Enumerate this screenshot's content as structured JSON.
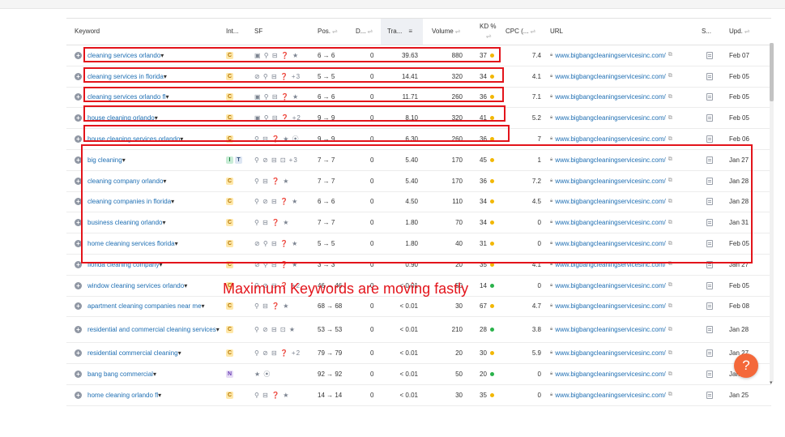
{
  "columns": {
    "keyword": "Keyword",
    "intent": "Int...",
    "sf": "SF",
    "pos": "Pos.",
    "diff": "D...",
    "traffic": "Tra...",
    "volume": "Volume",
    "kd": "KD %",
    "cpc": "CPC (...",
    "url": "URL",
    "serp": "S...",
    "updated": "Upd."
  },
  "colors": {
    "link": "#1f6fb3",
    "annotation": "#e3141b",
    "kd_yellow": "#f2b705",
    "kd_green": "#2ab24b",
    "help_button": "#f4683a"
  },
  "rows": [
    {
      "keyword": "cleaning services orlando",
      "intents": [
        "C"
      ],
      "sf": "▣ ⚲ ⊟ ❓ ★",
      "sf_extra": "",
      "pos": "6 → 6",
      "diff": "0",
      "traffic": "39.63",
      "volume": "880",
      "kd": "37",
      "kd_color": "yellow",
      "cpc": "7.4",
      "url": "www.bigbangcleaningservicesinc.com/",
      "updated": "Feb 07"
    },
    {
      "keyword": "cleaning services in florida",
      "intents": [
        "C"
      ],
      "sf": "⊘ ⚲ ⊟ ❓",
      "sf_extra": "+3",
      "pos": "5 → 5",
      "diff": "0",
      "traffic": "14.41",
      "volume": "320",
      "kd": "34",
      "kd_color": "yellow",
      "cpc": "4.1",
      "url": "www.bigbangcleaningservicesinc.com/",
      "updated": "Feb 05"
    },
    {
      "keyword": "cleaning services orlando fl",
      "intents": [
        "C"
      ],
      "sf": "▣ ⚲ ⊟ ❓ ★",
      "sf_extra": "",
      "pos": "6 → 6",
      "diff": "0",
      "traffic": "11.71",
      "volume": "260",
      "kd": "36",
      "kd_color": "yellow",
      "cpc": "7.1",
      "url": "www.bigbangcleaningservicesinc.com/",
      "updated": "Feb 05"
    },
    {
      "keyword": "house cleaning orlando",
      "intents": [
        "C"
      ],
      "sf": "▣ ⚲ ⊟ ❓",
      "sf_extra": "+2",
      "pos": "9 → 9",
      "diff": "0",
      "traffic": "8.10",
      "volume": "320",
      "kd": "41",
      "kd_color": "yellow",
      "cpc": "5.2",
      "url": "www.bigbangcleaningservicesinc.com/",
      "updated": "Feb 05"
    },
    {
      "keyword": "house cleaning services orlando",
      "intents": [
        "C"
      ],
      "sf": "⚲ ⊟ ❓ ★ ⦿",
      "sf_extra": "",
      "pos": "9 → 9",
      "diff": "0",
      "traffic": "6.30",
      "volume": "260",
      "kd": "36",
      "kd_color": "yellow",
      "cpc": "7",
      "url": "www.bigbangcleaningservicesinc.com/",
      "updated": "Feb 06"
    },
    {
      "keyword": "big cleaning",
      "intents": [
        "I",
        "T"
      ],
      "sf": "⚲ ⊘ ⊟ ⊡",
      "sf_extra": "+3",
      "pos": "7 → 7",
      "diff": "0",
      "traffic": "5.40",
      "volume": "170",
      "kd": "45",
      "kd_color": "yellow",
      "cpc": "1",
      "url": "www.bigbangcleaningservicesinc.com/",
      "updated": "Jan 27"
    },
    {
      "keyword": "cleaning company orlando",
      "intents": [
        "C"
      ],
      "sf": "⚲ ⊟ ❓ ★",
      "sf_extra": "",
      "pos": "7 → 7",
      "diff": "0",
      "traffic": "5.40",
      "volume": "170",
      "kd": "36",
      "kd_color": "yellow",
      "cpc": "7.2",
      "url": "www.bigbangcleaningservicesinc.com/",
      "updated": "Jan 28"
    },
    {
      "keyword": "cleaning companies in florida",
      "intents": [
        "C"
      ],
      "sf": "⚲ ⊘ ⊟ ❓ ★",
      "sf_extra": "",
      "pos": "6 → 6",
      "diff": "0",
      "traffic": "4.50",
      "volume": "110",
      "kd": "34",
      "kd_color": "yellow",
      "cpc": "4.5",
      "url": "www.bigbangcleaningservicesinc.com/",
      "updated": "Jan 28"
    },
    {
      "keyword": "business cleaning orlando",
      "intents": [
        "C"
      ],
      "sf": "⚲ ⊟ ❓ ★",
      "sf_extra": "",
      "pos": "7 → 7",
      "diff": "0",
      "traffic": "1.80",
      "volume": "70",
      "kd": "34",
      "kd_color": "yellow",
      "cpc": "0",
      "url": "www.bigbangcleaningservicesinc.com/",
      "updated": "Jan 31"
    },
    {
      "keyword": "home cleaning services florida",
      "intents": [
        "C"
      ],
      "sf": "⊘ ⚲ ⊟ ❓ ★",
      "sf_extra": "",
      "pos": "5 → 5",
      "diff": "0",
      "traffic": "1.80",
      "volume": "40",
      "kd": "31",
      "kd_color": "yellow",
      "cpc": "0",
      "url": "www.bigbangcleaningservicesinc.com/",
      "updated": "Feb 05"
    },
    {
      "keyword": "florida cleaning company",
      "intents": [
        "C"
      ],
      "sf": "⊘ ⚲ ⊟ ❓ ★",
      "sf_extra": "",
      "pos": "3 → 3",
      "diff": "0",
      "traffic": "0.90",
      "volume": "20",
      "kd": "35",
      "kd_color": "yellow",
      "cpc": "4.1",
      "url": "www.bigbangcleaningservicesinc.com/",
      "updated": "Jan 27"
    },
    {
      "keyword": "window cleaning services orlando",
      "intents": [
        "C"
      ],
      "sf": "⚲ ⊘ ⊟ ❓",
      "sf_extra": "+2",
      "pos": "46 → 46",
      "diff": "0",
      "traffic": "< 0.01",
      "volume": "50",
      "kd": "14",
      "kd_color": "green",
      "cpc": "0",
      "url": "www.bigbangcleaningservicesinc.com/",
      "updated": "Feb 05"
    },
    {
      "keyword": "apartment cleaning companies near me",
      "intents": [
        "C"
      ],
      "sf": "⚲ ⊟ ❓ ★",
      "sf_extra": "",
      "pos": "68 → 68",
      "diff": "0",
      "traffic": "< 0.01",
      "volume": "30",
      "kd": "67",
      "kd_color": "yellow",
      "cpc": "4.7",
      "url": "www.bigbangcleaningservicesinc.com/",
      "updated": "Feb 08"
    },
    {
      "keyword": "residential and commercial cleaning services",
      "intents": [
        "C"
      ],
      "sf": "⚲ ⊘ ⊟ ⊡ ★",
      "sf_extra": "",
      "pos": "53 → 53",
      "diff": "0",
      "traffic": "< 0.01",
      "volume": "210",
      "kd": "28",
      "kd_color": "green",
      "cpc": "3.8",
      "url": "www.bigbangcleaningservicesinc.com/",
      "updated": "Jan 28"
    },
    {
      "keyword": "residential commercial cleaning",
      "intents": [
        "C"
      ],
      "sf": "⚲ ⊘ ⊟ ❓",
      "sf_extra": "+2",
      "pos": "79 → 79",
      "diff": "0",
      "traffic": "< 0.01",
      "volume": "20",
      "kd": "30",
      "kd_color": "yellow",
      "cpc": "5.9",
      "url": "www.bigbangcleaningservicesinc.com/",
      "updated": "Jan 27"
    },
    {
      "keyword": "bang bang commercial",
      "intents": [
        "N"
      ],
      "sf": "★ ⦿",
      "sf_extra": "",
      "pos": "92 → 92",
      "diff": "0",
      "traffic": "< 0.01",
      "volume": "50",
      "kd": "20",
      "kd_color": "green",
      "cpc": "0",
      "url": "www.bigbangcleaningservicesinc.com/",
      "updated": "Jan"
    },
    {
      "keyword": "home cleaning orlando fl",
      "intents": [
        "C"
      ],
      "sf": "⚲ ⊟ ❓ ★",
      "sf_extra": "",
      "pos": "14 → 14",
      "diff": "0",
      "traffic": "< 0.01",
      "volume": "30",
      "kd": "35",
      "kd_color": "yellow",
      "cpc": "0",
      "url": "www.bigbangcleaningservicesinc.com/",
      "updated": "Jan 25"
    }
  ],
  "annotation": {
    "text": "Maximum Keywords are moving fastly"
  },
  "help_button": {
    "label": "?"
  }
}
